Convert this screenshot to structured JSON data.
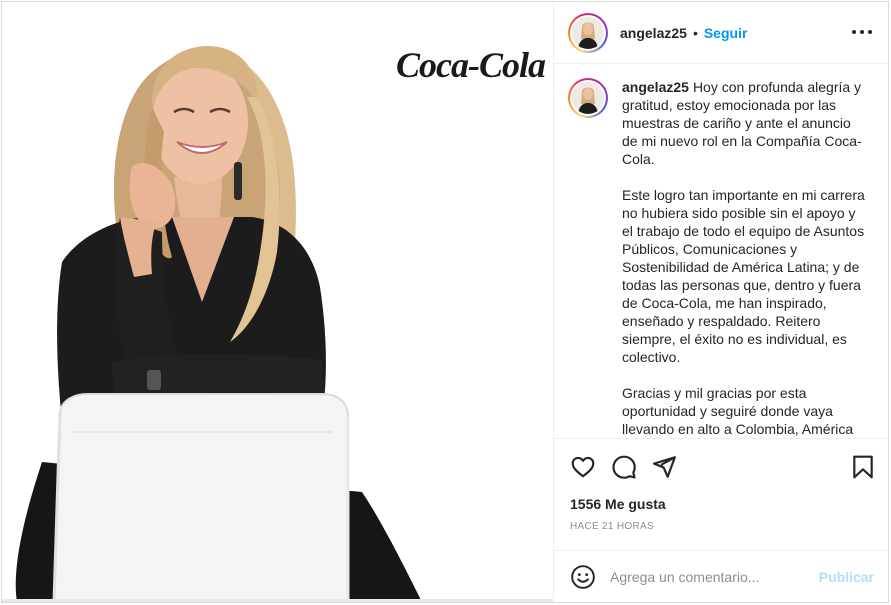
{
  "post": {
    "username": "angelaz25",
    "follow_label": "Seguir",
    "dot": "•",
    "brand_logo_text": "Coca-Cola",
    "caption": {
      "username": "angelaz25",
      "paragraph1": "Hoy con profunda alegría y gratitud, estoy emocionada por las muestras de cariño y ante el anuncio de mi nuevo rol en la Compañía Coca-Cola.",
      "paragraph2": "Este logro tan importante en mi carrera no hubiera sido posible sin el apoyo y el trabajo de todo el equipo de Asuntos Públicos, Comunicaciones y Sostenibilidad de América Latina; y de todas las personas que, dentro y fuera de Coca-Cola, me han inspirado, enseñado y respaldado. Reitero siempre, el éxito no es individual, es colectivo.",
      "paragraph3": "Gracias y mil gracias por esta oportunidad y seguiré donde vaya llevando en alto a Colombia, América Latina y a Coca-Cola."
    },
    "likes_text": "1556 Me gusta",
    "time_text": "HACE 21 HORAS",
    "comment_placeholder": "Agrega un comentario...",
    "publish_label": "Publicar"
  },
  "icons": {
    "like": "heart-icon",
    "comment": "comment-icon",
    "share": "paper-plane-icon",
    "save": "bookmark-icon",
    "more": "more-horizontal-icon",
    "emoji": "emoji-icon"
  },
  "colors": {
    "link_blue": "#0095f6",
    "publish_disabled": "#b2dffc",
    "secondary_text": "#8e8e8e",
    "border": "#efefef",
    "coca_cola_text": "#1a1a1a"
  }
}
